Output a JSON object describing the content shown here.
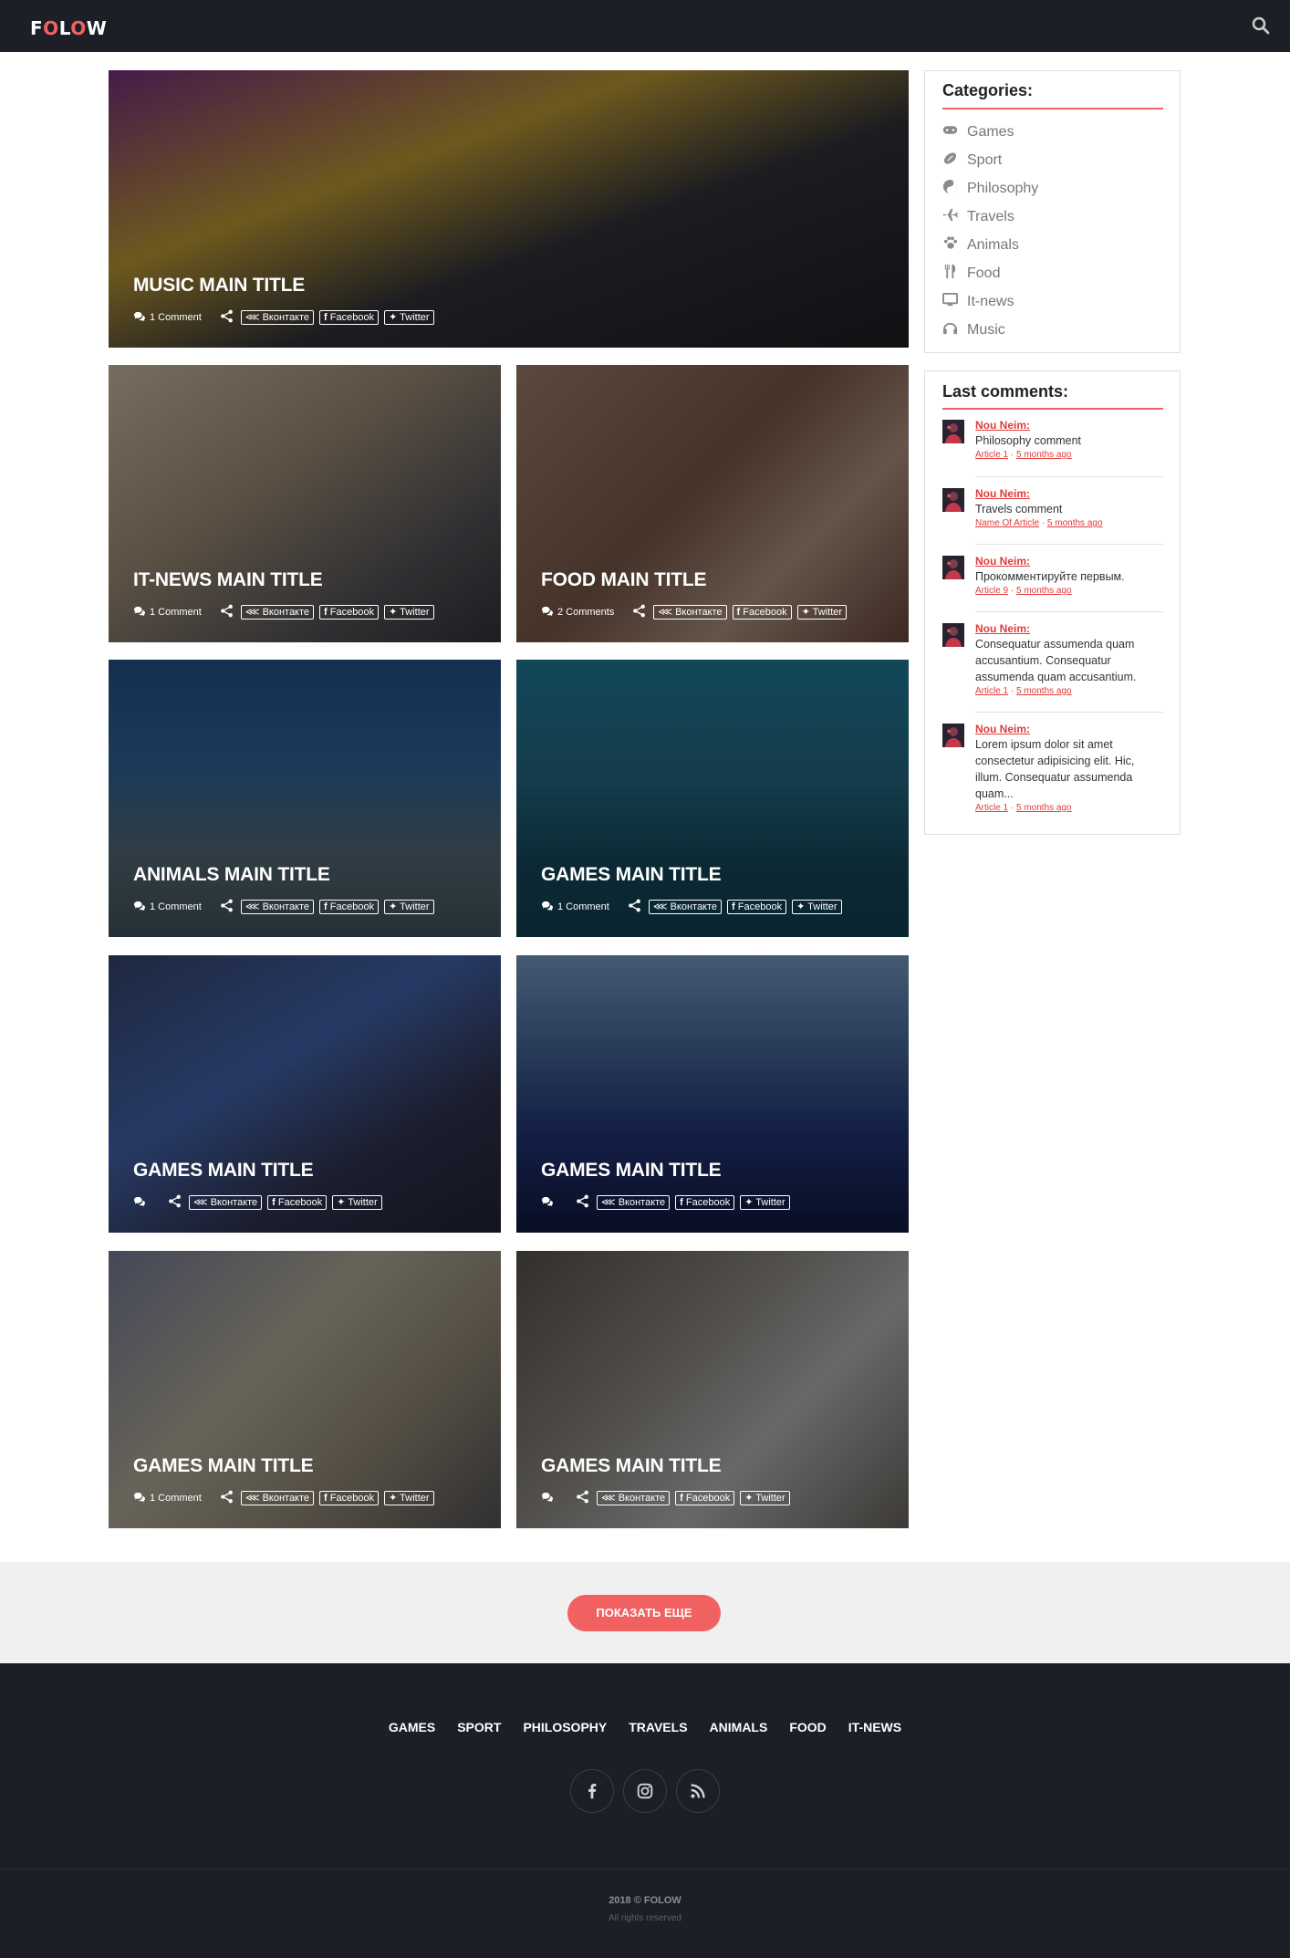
{
  "header": {
    "logo_pre": "F",
    "logo_o": "O",
    "logo_mid": "L",
    "logo_o2": "O",
    "logo_post": "W"
  },
  "cards": [
    {
      "title": "Music main title",
      "comments": "1 Comment"
    },
    {
      "title": "IT-News main title",
      "comments": "1 Comment"
    },
    {
      "title": "Food main title",
      "comments": "2 Comments"
    },
    {
      "title": "Animals main title",
      "comments": "1 Comment"
    },
    {
      "title": "Games main title",
      "comments": "1 Comment"
    },
    {
      "title": "Games main title",
      "comments": ""
    },
    {
      "title": "Games main title",
      "comments": ""
    },
    {
      "title": "Games main title",
      "comments": "1 Comment"
    },
    {
      "title": "Games main title",
      "comments": ""
    }
  ],
  "share": {
    "vk": "Вконтакте",
    "fb": "Facebook",
    "tw": "Twitter"
  },
  "categories": {
    "title": "Categories:",
    "items": [
      "Games",
      "Sport",
      "Philosophy",
      "Travels",
      "Animals",
      "Food",
      "It-news",
      "Music"
    ]
  },
  "last_comments": {
    "title": "Last comments:",
    "items": [
      {
        "author": "Nou Neim:",
        "text": "Philosophy comment",
        "article": "Article 1",
        "time": "5 months ago"
      },
      {
        "author": "Nou Neim:",
        "text": "Travels comment",
        "article": "Name Of Article",
        "time": "5 months ago"
      },
      {
        "author": "Nou Neim:",
        "text": "Прокомментируйте первым.",
        "article": "Article 9",
        "time": "5 months ago"
      },
      {
        "author": "Nou Neim:",
        "text": "Consequatur assumenda quam accusantium. Consequatur assumenda quam accusantium.",
        "article": "Article 1",
        "time": "5 months ago"
      },
      {
        "author": "Nou Neim:",
        "text": "Lorem ipsum dolor sit amet consectetur adipisicing elit. Hic, illum. Consequatur assumenda quam...",
        "article": "Article 1",
        "time": "5 months ago"
      }
    ]
  },
  "show_more": "ПОКАЗАТЬ ЕЩЕ",
  "footer": {
    "nav": [
      "GAMES",
      "SPORT",
      "PHILOSOPHY",
      "TRAVELS",
      "ANIMALS",
      "FOOD",
      "IT-NEWS"
    ],
    "socials": [
      "facebook-icon",
      "instagram-icon",
      "rss-icon"
    ],
    "copyright": "2018 © FOLOW",
    "rights": "All rights reserved"
  },
  "colors": {
    "accent": "#f16161",
    "dark": "#1c1f26"
  }
}
